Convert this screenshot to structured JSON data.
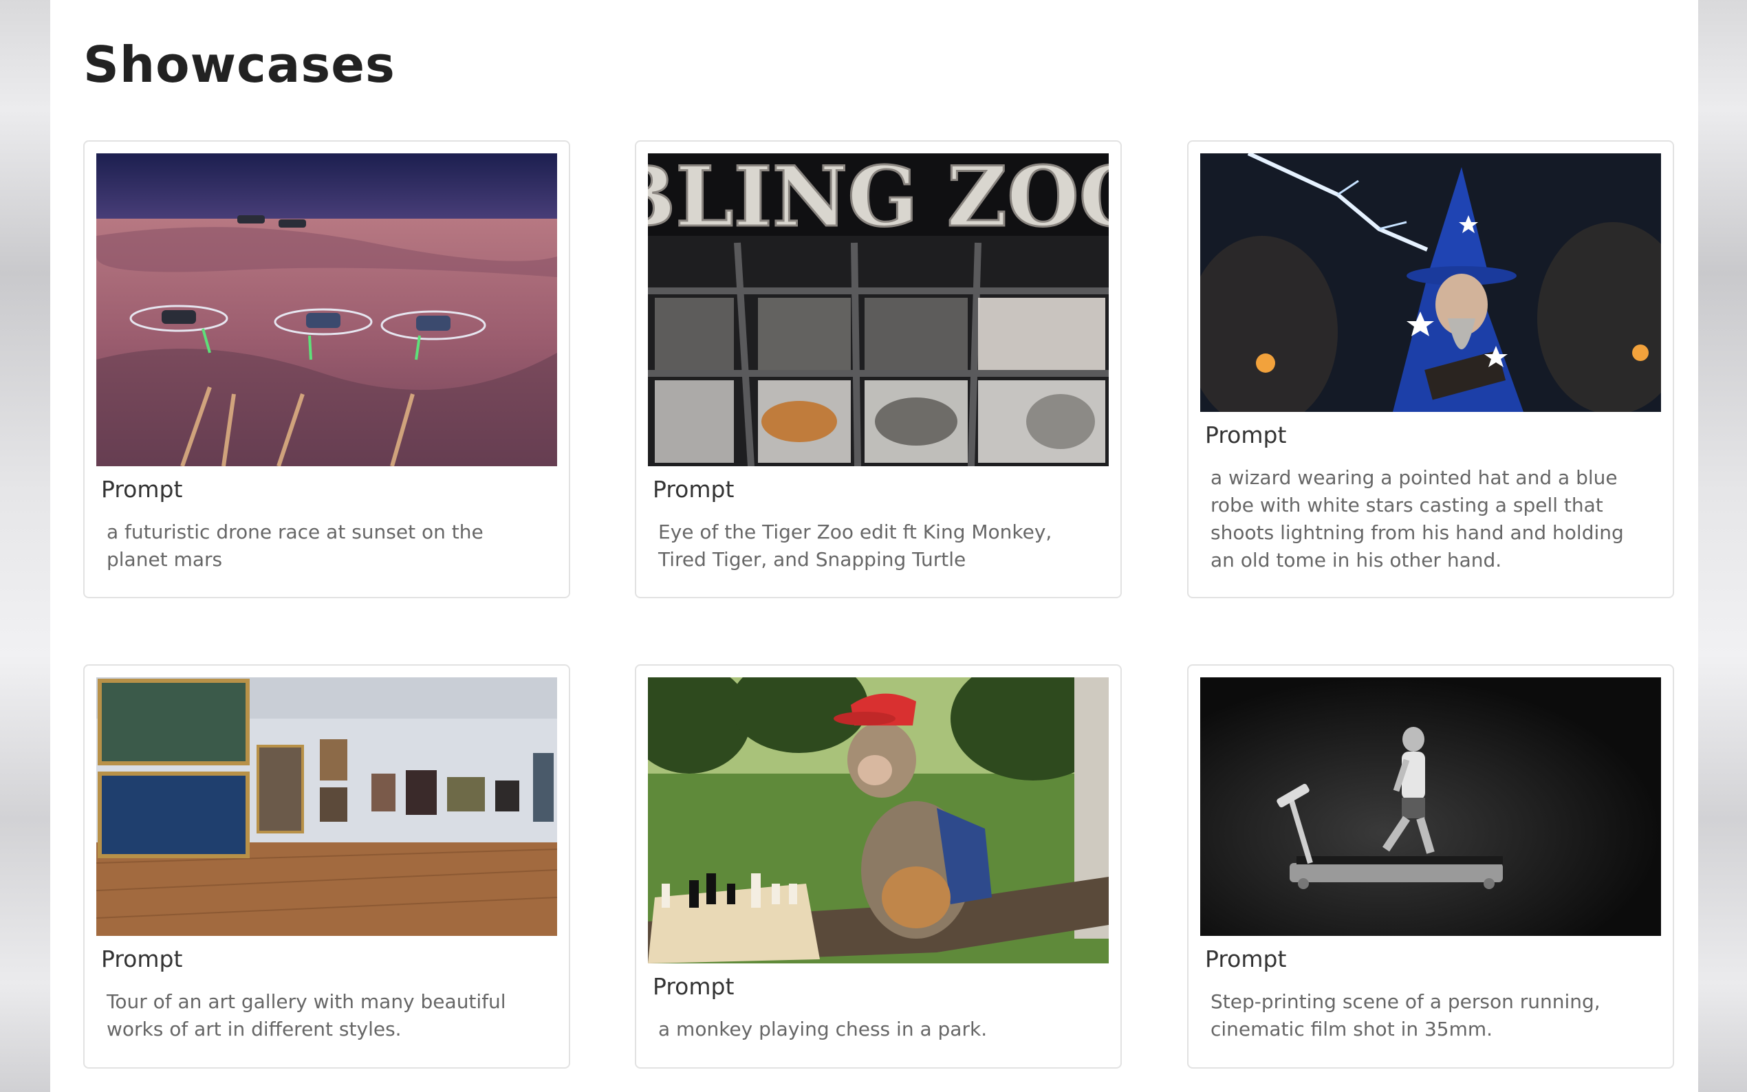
{
  "page": {
    "title": "Showcases"
  },
  "cards": [
    {
      "label": "Prompt",
      "description": "a futuristic drone race at sunset on the planet mars",
      "image": "drone-race-mars"
    },
    {
      "label": "Prompt",
      "description": "Eye of the Tiger Zoo edit ft King Monkey, Tired Tiger, and Snapping Turtle",
      "image": "bling-zoo",
      "image_text": "BLING ZOO"
    },
    {
      "label": "Prompt",
      "description": "a wizard wearing a pointed hat and a blue robe with white stars casting a spell that shoots lightning from his hand and holding an old tome in his other hand.",
      "image": "wizard-lightning"
    },
    {
      "label": "Prompt",
      "description": "Tour of an art gallery with many beautiful works of art in different styles.",
      "image": "art-gallery"
    },
    {
      "label": "Prompt",
      "description": "a monkey playing chess in a park.",
      "image": "monkey-chess"
    },
    {
      "label": "Prompt",
      "description": "Step-printing scene of a person running, cinematic film shot in 35mm.",
      "image": "treadmill-runner"
    }
  ]
}
